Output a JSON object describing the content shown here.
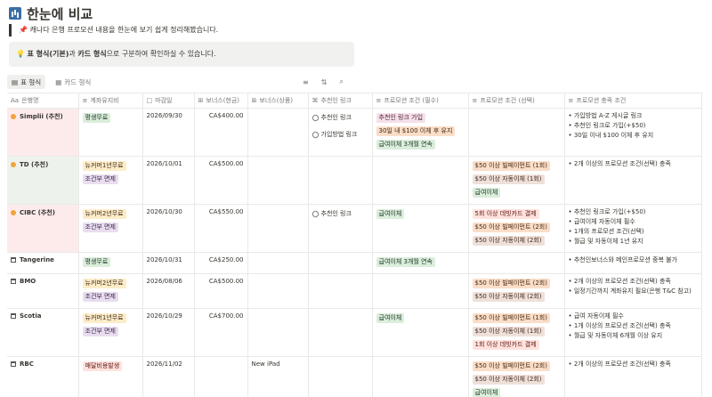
{
  "page": {
    "title": "한눈에 비교",
    "title_icon": "bar-chart-icon",
    "quote_emoji": "📌",
    "quote": "캐나다 은행 프로모션 내용을 한눈에 보기 쉽게 정리해봤습니다.",
    "callout_emoji": "💡",
    "callout_bold": "표 형식(기본)",
    "callout_mid": "과 ",
    "callout_bold2": "카드 형식",
    "callout_tail": "으로 구분하여 확인하실 수 있습니다."
  },
  "views": [
    {
      "label": "표 형식",
      "icon": "table-icon",
      "active": true
    },
    {
      "label": "카드 형식",
      "icon": "grid-icon",
      "active": false
    }
  ],
  "tools": [
    "≡",
    "⇅",
    "⌕"
  ],
  "columns": [
    "은행명",
    "계좌유지비",
    "마감일",
    "보너스(현금)",
    "보너스(상품)",
    "추천인 링크",
    "프로모션 조건 (필수)",
    "프로모션 조건 (선택)",
    "프로모션 충족 조건"
  ],
  "column_icons": [
    "Aa",
    "≡",
    "□",
    "⊞",
    "⊞",
    "⌘",
    "≡",
    "≡",
    "≡"
  ],
  "rows": [
    {
      "name": "Simplii (추천)",
      "icon": "star-icon",
      "fees": [
        {
          "t": "평생무료",
          "c": "green"
        }
      ],
      "deadline": "2026/09/30",
      "cash": "CA$400.00",
      "gift": "",
      "links": [
        "추천인 링크",
        "가입방법 링크"
      ],
      "req": [
        {
          "t": "추천인 링크 가입",
          "c": "pink"
        },
        {
          "t": "30일 내 $100 이체 후 유지",
          "c": "orange"
        },
        {
          "t": "급여이체 3개월 연속",
          "c": "green"
        }
      ],
      "opt": [],
      "met": [
        "• 가입방법 A-Z 게시글 링크",
        "• 추천인 링크로 가입(+$50)",
        "• 30일 이내 $100 이체 후 유지"
      ]
    },
    {
      "name": "TD (추천)",
      "icon": "star-icon",
      "fees": [
        {
          "t": "뉴커머1년무료",
          "c": "yellow"
        },
        {
          "t": "조건부 면제",
          "c": "purple"
        }
      ],
      "deadline": "2026/10/01",
      "cash": "CA$500.00",
      "gift": "",
      "links": [],
      "req": [],
      "opt": [
        {
          "t": "$50 이상 빌페이먼트 (1회)",
          "c": "orange"
        },
        {
          "t": "$50 이상 자동이체 (1회)",
          "c": "brown"
        },
        {
          "t": "급여이체",
          "c": "green"
        }
      ],
      "met": [
        "• 2개 이상의 프로모션 조건(선택) 충족"
      ]
    },
    {
      "name": "CIBC (추천)",
      "icon": "star-icon",
      "fees": [
        {
          "t": "뉴커머2년무료",
          "c": "yellow"
        },
        {
          "t": "조건부 면제",
          "c": "purple"
        }
      ],
      "deadline": "2026/10/30",
      "cash": "CA$550.00",
      "gift": "",
      "links": [
        "추천인 링크"
      ],
      "req": [
        {
          "t": "급여이체",
          "c": "green"
        }
      ],
      "opt": [
        {
          "t": "5회 이상 데빗카드 결제",
          "c": "red"
        },
        {
          "t": "$50 이상 빌페이먼트 (2회)",
          "c": "orange"
        },
        {
          "t": "$50 이상 자동이체 (2회)",
          "c": "brown"
        }
      ],
      "met": [
        "• 추천인 링크로 가입(+$50)",
        "• 급여이체 자동이체 필수",
        "• 1개의 프로모션 조건(선택)",
        "• 월급 및 자동이체 1년 유지"
      ]
    },
    {
      "name": "Tangerine",
      "icon": "bank-icon",
      "fees": [
        {
          "t": "평생무료",
          "c": "green"
        }
      ],
      "deadline": "2026/10/31",
      "cash": "CA$250.00",
      "gift": "",
      "links": [],
      "req": [
        {
          "t": "급여이체 3개월 연속",
          "c": "green"
        }
      ],
      "opt": [],
      "met": [
        "• 추천인보너스와 메인프로모션 중복 불가"
      ]
    },
    {
      "name": "BMO",
      "icon": "bank-icon",
      "fees": [
        {
          "t": "뉴커머2년무료",
          "c": "yellow"
        },
        {
          "t": "조건부 면제",
          "c": "purple"
        }
      ],
      "deadline": "2026/08/06",
      "cash": "CA$500.00",
      "gift": "",
      "links": [],
      "req": [],
      "opt": [
        {
          "t": "$50 이상 빌페이먼트 (2회)",
          "c": "orange"
        },
        {
          "t": "$50 이상 자동이체 (2회)",
          "c": "brown"
        }
      ],
      "met": [
        "• 2개 이상의 프로모션 조건(선택) 충족",
        "• 일정기간까지 계좌유지 필요(은행 T&C 참고)"
      ]
    },
    {
      "name": "Scotia",
      "icon": "bank-icon",
      "fees": [
        {
          "t": "뉴커머1년무료",
          "c": "yellow"
        },
        {
          "t": "조건부 면제",
          "c": "purple"
        }
      ],
      "deadline": "2026/10/29",
      "cash": "CA$700.00",
      "gift": "",
      "links": [],
      "req": [
        {
          "t": "급여이체",
          "c": "green"
        }
      ],
      "opt": [
        {
          "t": "$50 이상 빌페이먼트 (1회)",
          "c": "orange"
        },
        {
          "t": "$50 이상 자동이체 (1회)",
          "c": "brown"
        },
        {
          "t": "1회 이상 데빗카드 결제",
          "c": "red"
        }
      ],
      "met": [
        "• 급여 자동이체 필수",
        "• 1개 이상의 프로모션 조건(선택) 충족",
        "• 월급 및 자동이체 6개월 이상 유지"
      ]
    },
    {
      "name": "RBC",
      "icon": "bank-icon",
      "fees": [
        {
          "t": "매달비용발생",
          "c": "red"
        }
      ],
      "deadline": "2026/11/02",
      "cash": "",
      "gift": "New iPad",
      "links": [],
      "req": [],
      "opt": [
        {
          "t": "$50 이상 빌페이먼트 (2회)",
          "c": "orange"
        },
        {
          "t": "$50 이상 자동이체 (2회)",
          "c": "brown"
        },
        {
          "t": "급여이체",
          "c": "green"
        }
      ],
      "met": [
        "• 2개 이상의 프로모션 조건(선택) 충족"
      ]
    }
  ]
}
